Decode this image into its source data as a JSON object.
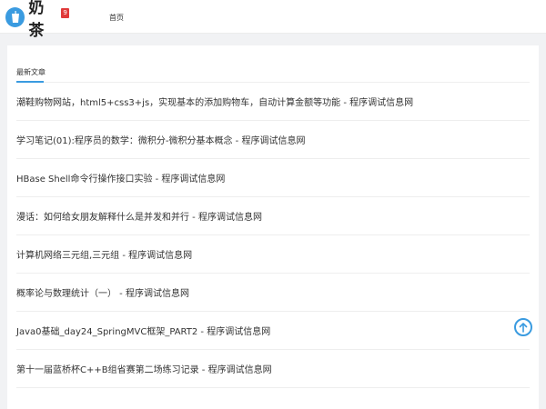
{
  "header": {
    "logo_text": "奶茶",
    "logo_badge": "9",
    "nav": [
      {
        "label": "首页"
      }
    ]
  },
  "section": {
    "title": "最新文章"
  },
  "articles": [
    {
      "title": "潮鞋购物网站，html5+css3+js，实现基本的添加购物车，自动计算金额等功能 - 程序调试信息网"
    },
    {
      "title": "学习笔记(01):程序员的数学：微积分-微积分基本概念 - 程序调试信息网"
    },
    {
      "title": "HBase Shell命令行操作接口实验 - 程序调试信息网"
    },
    {
      "title": "漫话：如何给女朋友解释什么是并发和并行 - 程序调试信息网"
    },
    {
      "title": "计算机网络三元组,三元组 - 程序调试信息网"
    },
    {
      "title": "概率论与数理统计（一） - 程序调试信息网"
    },
    {
      "title": "Java0基础_day24_SpringMVC框架_PART2 - 程序调试信息网"
    },
    {
      "title": "第十一届蓝桥杯C++B组省赛第二场练习记录 - 程序调试信息网"
    }
  ],
  "colors": {
    "accent": "#3a9be0",
    "badge": "#e03a3a",
    "page_bg": "#f1f2f4"
  },
  "icons": {
    "logo": "cup-icon",
    "back_to_top": "arrow-up-icon"
  }
}
